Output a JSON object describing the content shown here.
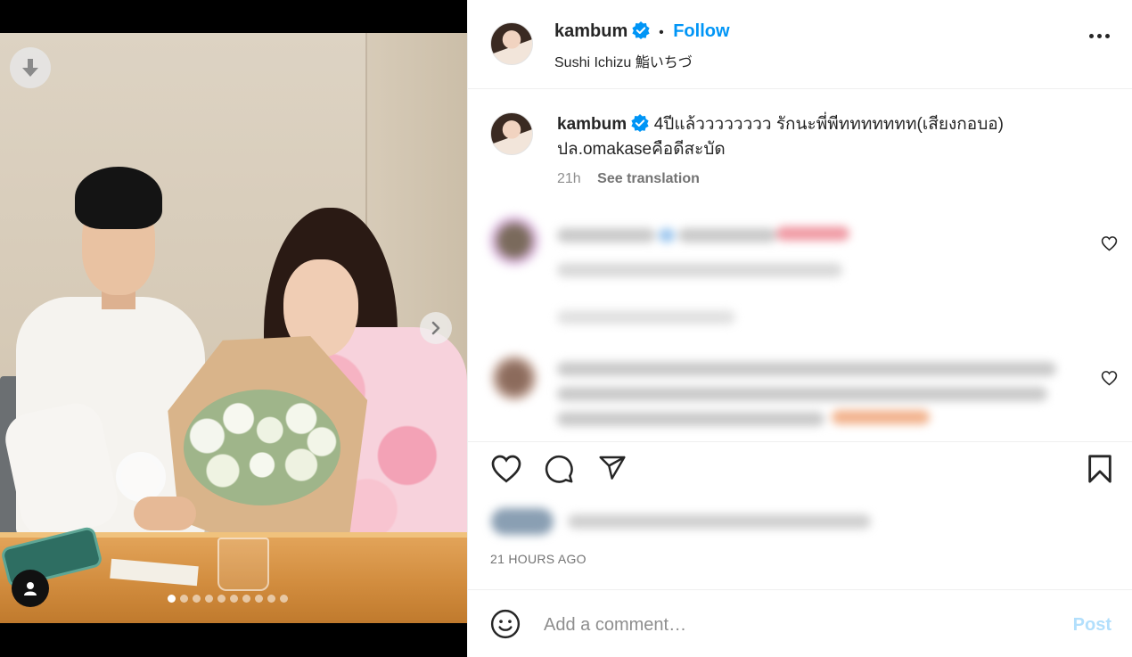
{
  "post": {
    "username": "kambum",
    "follow_label": "Follow",
    "separator": "•",
    "location": "Sushi Ichizu 鮨いちづ"
  },
  "caption": {
    "username": "kambum",
    "text_line1": "4ปีแล้วววววววว รักนะพี่พีททททททท(เสียงกอบอ)",
    "text_line2": "ปล.omakaseคือดีสะบัด",
    "time": "21h",
    "see_translation": "See translation"
  },
  "media": {
    "slide_count": 10,
    "active_slide": 0
  },
  "footer": {
    "timestamp": "21 HOURS AGO",
    "comment_placeholder": "Add a comment…",
    "post_label": "Post"
  },
  "colors": {
    "accent": "#0095f6",
    "verified": "#0095f6",
    "post_disabled": "#b2dffc",
    "muted": "#8e8e8e"
  },
  "icons": {
    "download": "download-icon",
    "next": "chevron-right-icon",
    "tag": "user-tag-icon",
    "more": "more-options-icon",
    "like": "heart-icon",
    "comment": "comment-icon",
    "share": "share-icon",
    "save": "bookmark-icon",
    "emoji": "emoji-icon"
  }
}
